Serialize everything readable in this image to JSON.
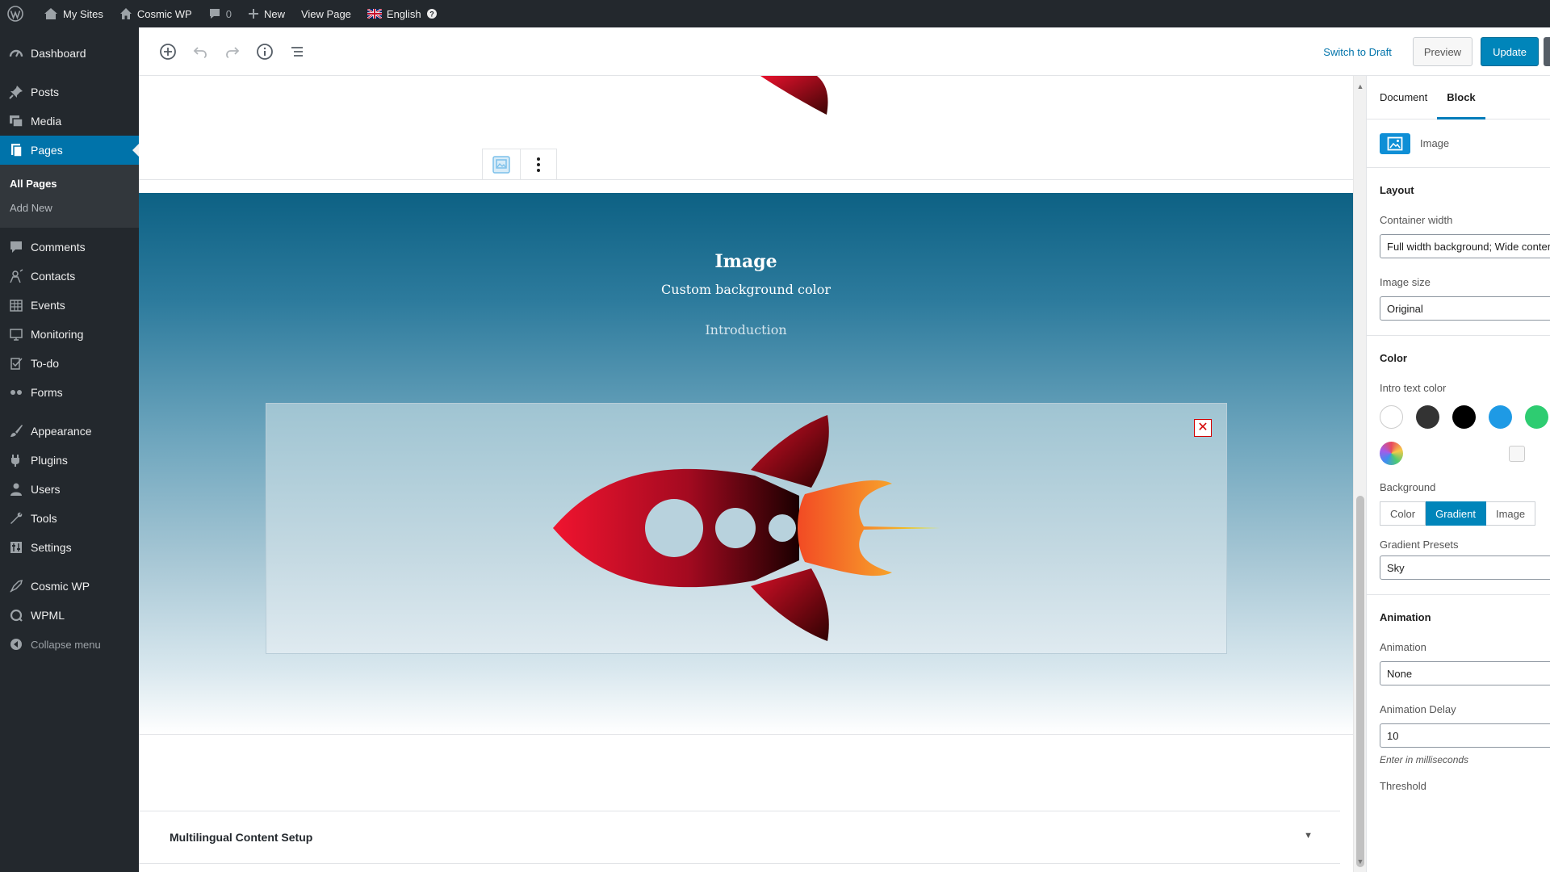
{
  "adminbar": {
    "wp_logo": "wordpress-icon",
    "my_sites": "My Sites",
    "site_name": "Cosmic WP",
    "comments_count": "0",
    "new_label": "New",
    "view_page": "View Page",
    "language": "English"
  },
  "sidebar": {
    "dashboard": "Dashboard",
    "posts": "Posts",
    "media": "Media",
    "pages": "Pages",
    "all_pages": "All Pages",
    "add_new": "Add New",
    "comments": "Comments",
    "contacts": "Contacts",
    "events": "Events",
    "monitoring": "Monitoring",
    "todo": "To-do",
    "forms": "Forms",
    "appearance": "Appearance",
    "plugins": "Plugins",
    "users": "Users",
    "tools": "Tools",
    "settings": "Settings",
    "cosmic_wp": "Cosmic WP",
    "wpml": "WPML",
    "collapse": "Collapse menu"
  },
  "toolbar": {
    "switch_to_draft": "Switch to Draft",
    "preview": "Preview",
    "update": "Update"
  },
  "hero": {
    "title": "Image",
    "subtitle": "Custom background color",
    "intro": "Introduction",
    "remove_glyph": "✕"
  },
  "multilingual": {
    "title": "Multilingual Content Setup",
    "arrow": "▼"
  },
  "panel": {
    "tab_document": "Document",
    "tab_block": "Block",
    "block_name": "Image",
    "layout_title": "Layout",
    "container_width_label": "Container width",
    "container_width_value": "Full width background; Wide content",
    "image_size_label": "Image size",
    "image_size_value": "Original",
    "color_title": "Color",
    "intro_text_color_label": "Intro text color",
    "swatches": [
      "#ffffff",
      "#333333",
      "#000000",
      "#1e9ae5",
      "#2ecc71"
    ],
    "background_label": "Background",
    "bg_color": "Color",
    "bg_gradient": "Gradient",
    "bg_image": "Image",
    "gradient_presets_label": "Gradient Presets",
    "gradient_presets_value": "Sky",
    "animation_title": "Animation",
    "animation_label": "Animation",
    "animation_value": "None",
    "animation_delay_label": "Animation Delay",
    "animation_delay_value": "10",
    "animation_delay_help": "Enter in milliseconds",
    "threshold_label": "Threshold"
  },
  "colors": {
    "admin_dark": "#23282d",
    "accent": "#0073aa",
    "update_blue": "#0085ba",
    "rocket_red": "#e8112d",
    "flame_orange": "#f77a2a"
  }
}
